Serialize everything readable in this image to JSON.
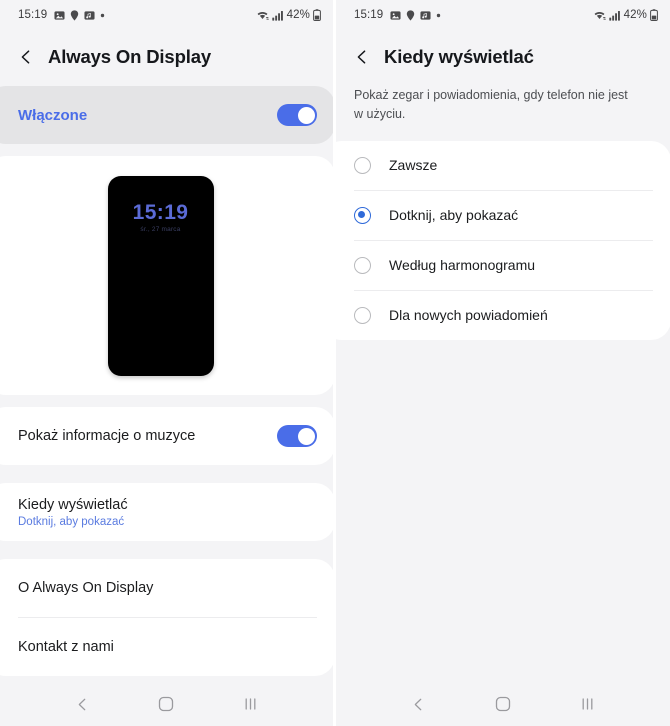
{
  "status_bar": {
    "time": "15:19",
    "battery_percent": "42%",
    "icons": [
      "gallery-icon",
      "location-icon",
      "music-note-icon",
      "dot-icon"
    ],
    "right_icons": [
      "wifi-icon",
      "signal-icon",
      "battery-icon"
    ]
  },
  "left_panel": {
    "back_icon": "back-chevron-icon",
    "title": "Always On Display",
    "master_toggle": {
      "label": "Włączone",
      "state": "on"
    },
    "preview": {
      "clock": "15:19",
      "date": "śr., 27 marca"
    },
    "music_row": {
      "label": "Pokaż informacje o muzyce",
      "state": "on"
    },
    "when_row": {
      "label": "Kiedy wyświetlać",
      "value": "Dotknij, aby pokazać"
    },
    "footer_items": [
      {
        "label": "O Always On Display"
      },
      {
        "label": "Kontakt z nami"
      }
    ]
  },
  "right_panel": {
    "back_icon": "back-chevron-icon",
    "title": "Kiedy wyświetlać",
    "description": "Pokaż zegar i powiadomienia, gdy telefon nie jest w użyciu.",
    "options": [
      {
        "label": "Zawsze",
        "selected": false
      },
      {
        "label": "Dotknij, aby pokazać",
        "selected": true
      },
      {
        "label": "Według harmonogramu",
        "selected": false
      },
      {
        "label": "Dla nowych powiadomień",
        "selected": false
      }
    ]
  },
  "nav_bar": {
    "back": "back-nav-icon",
    "home": "home-nav-icon",
    "recents": "recents-nav-icon"
  },
  "colors": {
    "accent_blue": "#4a6de8",
    "radio_blue": "#2f6ad9",
    "page_bg": "#f4f4f6",
    "card_bg": "#ffffff",
    "grey_card_bg": "#e4e4e6"
  }
}
